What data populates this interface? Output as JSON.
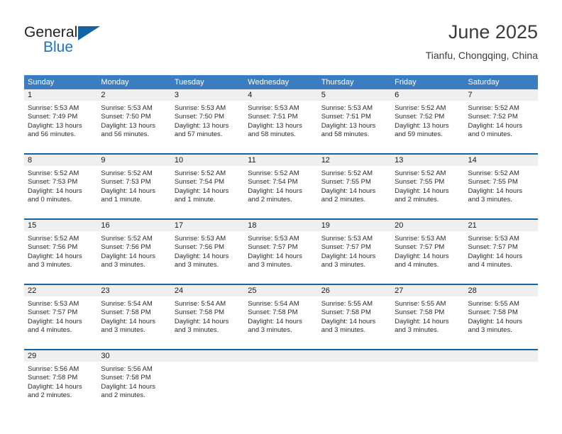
{
  "brand": {
    "name_part1": "General",
    "name_part2": "Blue",
    "triangle_icon": "blue-triangle-icon",
    "accent_color": "#1464a5"
  },
  "header": {
    "title": "June 2025",
    "subtitle": "Tianfu, Chongqing, China"
  },
  "colors": {
    "header_blue": "#3b7dc0",
    "row_border_blue": "#1464a5",
    "day_band_gray": "#efefef",
    "text": "#2b2b2b"
  },
  "weekdays": [
    "Sunday",
    "Monday",
    "Tuesday",
    "Wednesday",
    "Thursday",
    "Friday",
    "Saturday"
  ],
  "weeks": [
    [
      {
        "day": "1",
        "sunrise": "Sunrise: 5:53 AM",
        "sunset": "Sunset: 7:49 PM",
        "daylight_line1": "Daylight: 13 hours",
        "daylight_line2": "and 56 minutes."
      },
      {
        "day": "2",
        "sunrise": "Sunrise: 5:53 AM",
        "sunset": "Sunset: 7:50 PM",
        "daylight_line1": "Daylight: 13 hours",
        "daylight_line2": "and 56 minutes."
      },
      {
        "day": "3",
        "sunrise": "Sunrise: 5:53 AM",
        "sunset": "Sunset: 7:50 PM",
        "daylight_line1": "Daylight: 13 hours",
        "daylight_line2": "and 57 minutes."
      },
      {
        "day": "4",
        "sunrise": "Sunrise: 5:53 AM",
        "sunset": "Sunset: 7:51 PM",
        "daylight_line1": "Daylight: 13 hours",
        "daylight_line2": "and 58 minutes."
      },
      {
        "day": "5",
        "sunrise": "Sunrise: 5:53 AM",
        "sunset": "Sunset: 7:51 PM",
        "daylight_line1": "Daylight: 13 hours",
        "daylight_line2": "and 58 minutes."
      },
      {
        "day": "6",
        "sunrise": "Sunrise: 5:52 AM",
        "sunset": "Sunset: 7:52 PM",
        "daylight_line1": "Daylight: 13 hours",
        "daylight_line2": "and 59 minutes."
      },
      {
        "day": "7",
        "sunrise": "Sunrise: 5:52 AM",
        "sunset": "Sunset: 7:52 PM",
        "daylight_line1": "Daylight: 14 hours",
        "daylight_line2": "and 0 minutes."
      }
    ],
    [
      {
        "day": "8",
        "sunrise": "Sunrise: 5:52 AM",
        "sunset": "Sunset: 7:53 PM",
        "daylight_line1": "Daylight: 14 hours",
        "daylight_line2": "and 0 minutes."
      },
      {
        "day": "9",
        "sunrise": "Sunrise: 5:52 AM",
        "sunset": "Sunset: 7:53 PM",
        "daylight_line1": "Daylight: 14 hours",
        "daylight_line2": "and 1 minute."
      },
      {
        "day": "10",
        "sunrise": "Sunrise: 5:52 AM",
        "sunset": "Sunset: 7:54 PM",
        "daylight_line1": "Daylight: 14 hours",
        "daylight_line2": "and 1 minute."
      },
      {
        "day": "11",
        "sunrise": "Sunrise: 5:52 AM",
        "sunset": "Sunset: 7:54 PM",
        "daylight_line1": "Daylight: 14 hours",
        "daylight_line2": "and 2 minutes."
      },
      {
        "day": "12",
        "sunrise": "Sunrise: 5:52 AM",
        "sunset": "Sunset: 7:55 PM",
        "daylight_line1": "Daylight: 14 hours",
        "daylight_line2": "and 2 minutes."
      },
      {
        "day": "13",
        "sunrise": "Sunrise: 5:52 AM",
        "sunset": "Sunset: 7:55 PM",
        "daylight_line1": "Daylight: 14 hours",
        "daylight_line2": "and 2 minutes."
      },
      {
        "day": "14",
        "sunrise": "Sunrise: 5:52 AM",
        "sunset": "Sunset: 7:55 PM",
        "daylight_line1": "Daylight: 14 hours",
        "daylight_line2": "and 3 minutes."
      }
    ],
    [
      {
        "day": "15",
        "sunrise": "Sunrise: 5:52 AM",
        "sunset": "Sunset: 7:56 PM",
        "daylight_line1": "Daylight: 14 hours",
        "daylight_line2": "and 3 minutes."
      },
      {
        "day": "16",
        "sunrise": "Sunrise: 5:52 AM",
        "sunset": "Sunset: 7:56 PM",
        "daylight_line1": "Daylight: 14 hours",
        "daylight_line2": "and 3 minutes."
      },
      {
        "day": "17",
        "sunrise": "Sunrise: 5:53 AM",
        "sunset": "Sunset: 7:56 PM",
        "daylight_line1": "Daylight: 14 hours",
        "daylight_line2": "and 3 minutes."
      },
      {
        "day": "18",
        "sunrise": "Sunrise: 5:53 AM",
        "sunset": "Sunset: 7:57 PM",
        "daylight_line1": "Daylight: 14 hours",
        "daylight_line2": "and 3 minutes."
      },
      {
        "day": "19",
        "sunrise": "Sunrise: 5:53 AM",
        "sunset": "Sunset: 7:57 PM",
        "daylight_line1": "Daylight: 14 hours",
        "daylight_line2": "and 3 minutes."
      },
      {
        "day": "20",
        "sunrise": "Sunrise: 5:53 AM",
        "sunset": "Sunset: 7:57 PM",
        "daylight_line1": "Daylight: 14 hours",
        "daylight_line2": "and 4 minutes."
      },
      {
        "day": "21",
        "sunrise": "Sunrise: 5:53 AM",
        "sunset": "Sunset: 7:57 PM",
        "daylight_line1": "Daylight: 14 hours",
        "daylight_line2": "and 4 minutes."
      }
    ],
    [
      {
        "day": "22",
        "sunrise": "Sunrise: 5:53 AM",
        "sunset": "Sunset: 7:57 PM",
        "daylight_line1": "Daylight: 14 hours",
        "daylight_line2": "and 4 minutes."
      },
      {
        "day": "23",
        "sunrise": "Sunrise: 5:54 AM",
        "sunset": "Sunset: 7:58 PM",
        "daylight_line1": "Daylight: 14 hours",
        "daylight_line2": "and 3 minutes."
      },
      {
        "day": "24",
        "sunrise": "Sunrise: 5:54 AM",
        "sunset": "Sunset: 7:58 PM",
        "daylight_line1": "Daylight: 14 hours",
        "daylight_line2": "and 3 minutes."
      },
      {
        "day": "25",
        "sunrise": "Sunrise: 5:54 AM",
        "sunset": "Sunset: 7:58 PM",
        "daylight_line1": "Daylight: 14 hours",
        "daylight_line2": "and 3 minutes."
      },
      {
        "day": "26",
        "sunrise": "Sunrise: 5:55 AM",
        "sunset": "Sunset: 7:58 PM",
        "daylight_line1": "Daylight: 14 hours",
        "daylight_line2": "and 3 minutes."
      },
      {
        "day": "27",
        "sunrise": "Sunrise: 5:55 AM",
        "sunset": "Sunset: 7:58 PM",
        "daylight_line1": "Daylight: 14 hours",
        "daylight_line2": "and 3 minutes."
      },
      {
        "day": "28",
        "sunrise": "Sunrise: 5:55 AM",
        "sunset": "Sunset: 7:58 PM",
        "daylight_line1": "Daylight: 14 hours",
        "daylight_line2": "and 3 minutes."
      }
    ],
    [
      {
        "day": "29",
        "sunrise": "Sunrise: 5:56 AM",
        "sunset": "Sunset: 7:58 PM",
        "daylight_line1": "Daylight: 14 hours",
        "daylight_line2": "and 2 minutes."
      },
      {
        "day": "30",
        "sunrise": "Sunrise: 5:56 AM",
        "sunset": "Sunset: 7:58 PM",
        "daylight_line1": "Daylight: 14 hours",
        "daylight_line2": "and 2 minutes."
      },
      {
        "day": "",
        "sunrise": "",
        "sunset": "",
        "daylight_line1": "",
        "daylight_line2": ""
      },
      {
        "day": "",
        "sunrise": "",
        "sunset": "",
        "daylight_line1": "",
        "daylight_line2": ""
      },
      {
        "day": "",
        "sunrise": "",
        "sunset": "",
        "daylight_line1": "",
        "daylight_line2": ""
      },
      {
        "day": "",
        "sunrise": "",
        "sunset": "",
        "daylight_line1": "",
        "daylight_line2": ""
      },
      {
        "day": "",
        "sunrise": "",
        "sunset": "",
        "daylight_line1": "",
        "daylight_line2": ""
      }
    ]
  ]
}
